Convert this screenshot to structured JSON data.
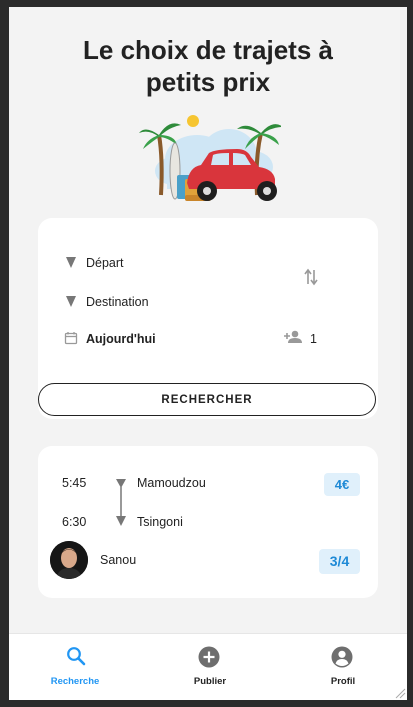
{
  "hero": {
    "title_line1": "Le choix de trajets à",
    "title_line2": "petits prix",
    "illustration_icon": "car-trip-illustration"
  },
  "search": {
    "departure_label": "Départ",
    "destination_label": "Destination",
    "date_label": "Aujourd'hui",
    "passengers_count": "1",
    "button_label": "RECHERCHER"
  },
  "result": {
    "departure_time": "5:45",
    "departure_place": "Mamoudzou",
    "arrival_time": "6:30",
    "arrival_place": "Tsingoni",
    "price": "4€",
    "driver_name": "Sanou",
    "seats": "3/4"
  },
  "nav": {
    "items": [
      {
        "label": "Recherche",
        "icon": "search-icon",
        "active": true
      },
      {
        "label": "Publier",
        "icon": "add-circle-icon",
        "active": false
      },
      {
        "label": "Profil",
        "icon": "account-circle-icon",
        "active": false
      }
    ]
  },
  "colors": {
    "accent": "#2196f3",
    "badge_bg": "#e0f0fb",
    "page_bg": "#f3f3f3",
    "text": "#222222",
    "icon_grey": "#777777"
  }
}
